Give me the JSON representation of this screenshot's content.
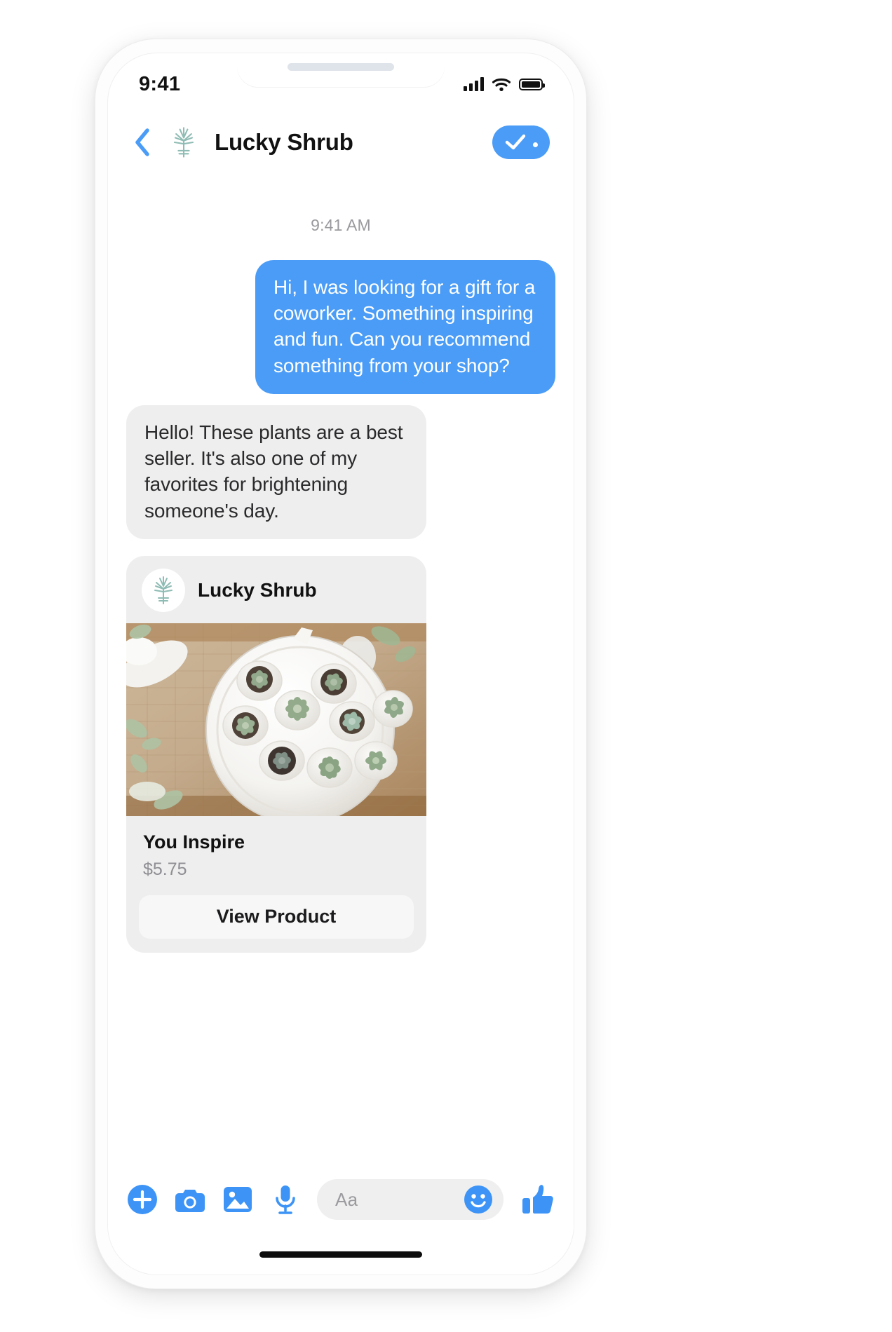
{
  "device": {
    "statusbar": {
      "time": "9:41",
      "signal_icon": "cellular-signal-icon",
      "wifi_icon": "wifi-icon",
      "battery_icon": "battery-full-icon"
    },
    "home_indicator": "home-indicator"
  },
  "header": {
    "back_icon": "back-chevron-icon",
    "avatar_icon": "lucky-shrub-logo-icon",
    "title": "Lucky Shrub",
    "action_icon": "checkmark-icon"
  },
  "conversation": {
    "timestamp": "9:41 AM",
    "messages": [
      {
        "id": "msg-outgoing-1",
        "direction": "out",
        "text": "Hi, I was looking for a gift for a coworker. Something inspiring and fun. Can you recommend something from your shop?"
      },
      {
        "id": "msg-incoming-1",
        "direction": "in",
        "text": "Hello! These plants are a best seller. It's also one of my favorites for brightening someone's day."
      }
    ],
    "product_card": {
      "brand": "Lucky Shrub",
      "brand_logo_icon": "lucky-shrub-logo-icon",
      "photo_alt": "white-ceramic-plate-with-succulents-on-wood-table",
      "title": "You Inspire",
      "price": "$5.75",
      "button_label": "View Product"
    },
    "side_avatar_icon": "lucky-shrub-sprig-icon"
  },
  "composer": {
    "actions": [
      {
        "id": "add-button",
        "icon": "plus-circle-icon"
      },
      {
        "id": "camera-button",
        "icon": "camera-icon"
      },
      {
        "id": "gallery-button",
        "icon": "image-icon"
      },
      {
        "id": "voice-button",
        "icon": "microphone-icon"
      }
    ],
    "input_placeholder": "Aa",
    "emoji_icon": "smiley-face-icon",
    "like_icon": "thumbs-up-icon"
  },
  "colors": {
    "accent_blue": "#4a9cf6",
    "bubble_gray": "#eeeeee",
    "brand_green": "#8fbcb4",
    "text_dark": "#111111",
    "text_muted": "#8e8e93"
  }
}
